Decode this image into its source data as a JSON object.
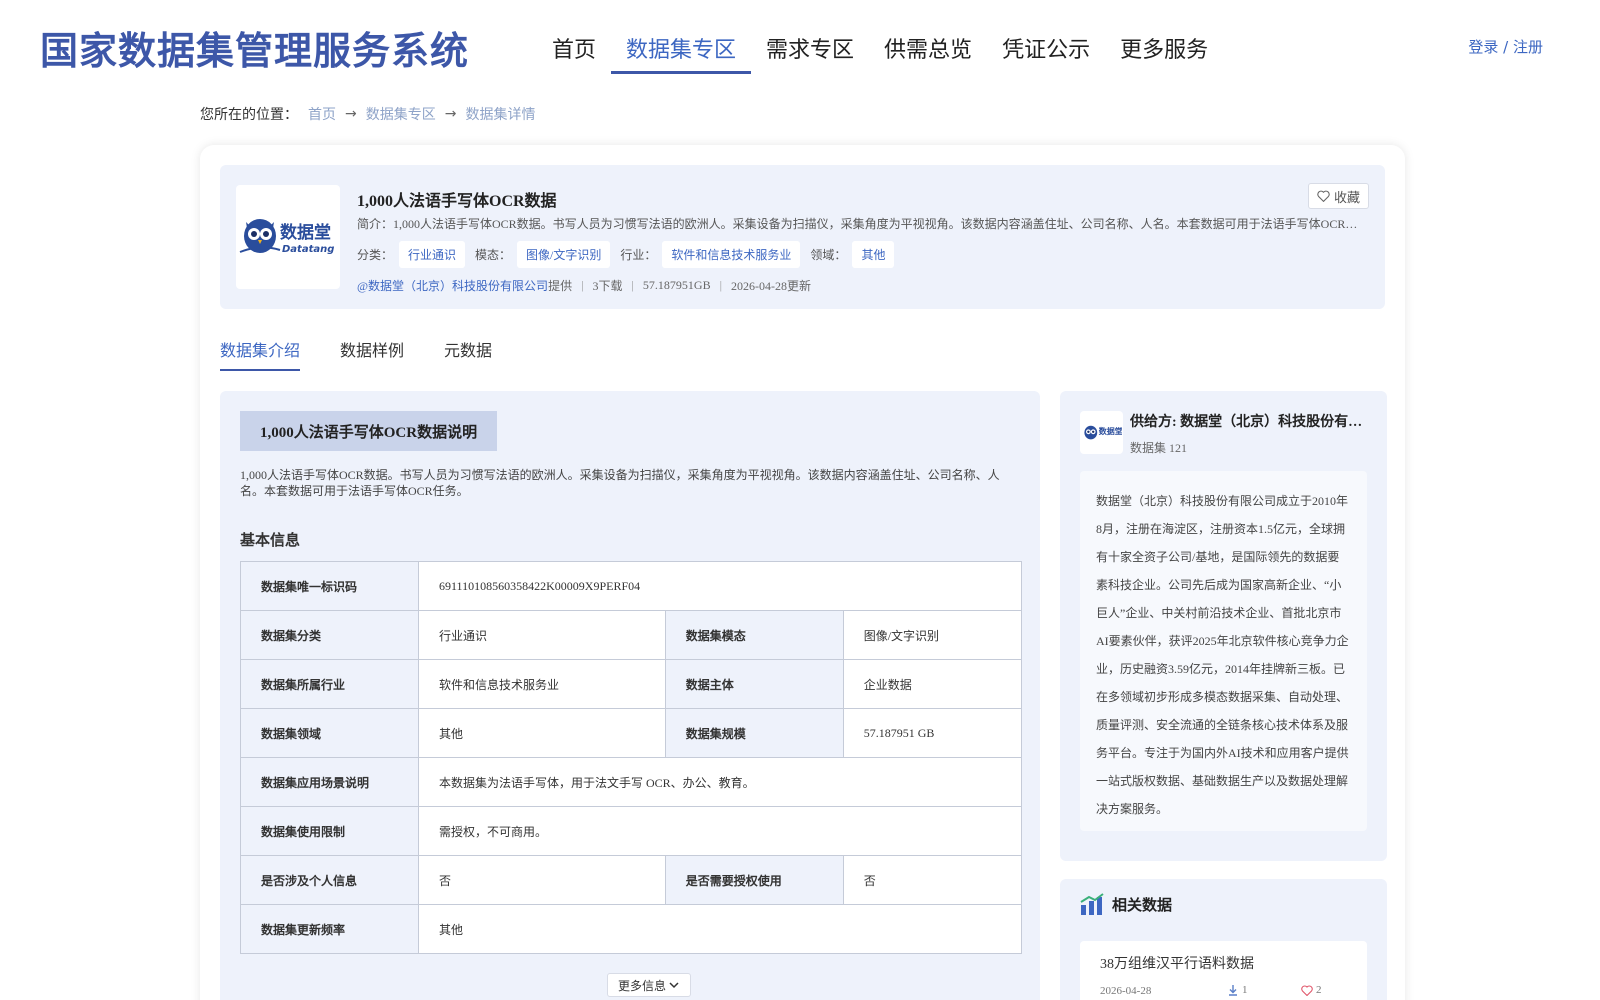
{
  "header": {
    "site_title": "国家数据集管理服务系统",
    "nav": [
      "首页",
      "数据集专区",
      "需求专区",
      "供需总览",
      "凭证公示",
      "更多服务"
    ],
    "active_nav": "数据集专区",
    "login": "登录 / 注册"
  },
  "breadcrumb": {
    "label": "您所在的位置：",
    "items": [
      "首页",
      "数据集专区",
      "数据集详情"
    ]
  },
  "dataset": {
    "logo_text": "数据堂",
    "logo_sub": "Datatang",
    "title": "1,000人法语手写体OCR数据",
    "favorite": "收藏",
    "intro": "简介：1,000人法语手写体OCR数据。书写人员为习惯写法语的欧洲人。采集设备为扫描仪，采集角度为平视视角。该数据内容涵盖住址、公司名称、人名。本套数据可用于法语手写体OCR任务。",
    "meta": {
      "category_label": "分类：",
      "category": "行业通识",
      "modality_label": "模态：",
      "modality": "图像/文字识别",
      "industry_label": "行业：",
      "industry": "软件和信息技术服务业",
      "domain_label": "领域：",
      "domain": "其他"
    },
    "provider": "@数据堂（北京）科技股份有限公司",
    "provider_suffix": "提供",
    "downloads": "3下载",
    "size": "57.187951GB",
    "updated": "2026-04-28更新"
  },
  "tabs": [
    "数据集介绍",
    "数据样例",
    "元数据"
  ],
  "intro_section": {
    "heading": "1,000人法语手写体OCR数据说明",
    "description": "1,000人法语手写体OCR数据。书写人员为习惯写法语的欧洲人。采集设备为扫描仪，采集角度为平视视角。该数据内容涵盖住址、公司名称、人名。本套数据可用于法语手写体OCR任务。",
    "basic_title": "基本信息",
    "more": "更多信息"
  },
  "basic_info": {
    "r0": {
      "k": "数据集唯一标识码",
      "v": "691110108560358422K00009X9PERF04"
    },
    "r1": {
      "k1": "数据集分类",
      "v1": "行业通识",
      "k2": "数据集模态",
      "v2": "图像/文字识别"
    },
    "r2": {
      "k1": "数据集所属行业",
      "v1": "软件和信息技术服务业",
      "k2": "数据主体",
      "v2": "企业数据"
    },
    "r3": {
      "k1": "数据集领域",
      "v1": "其他",
      "k2": "数据集规模",
      "v2": "57.187951 GB"
    },
    "r4": {
      "k": "数据集应用场景说明",
      "v": "本数据集为法语手写体，用于法文手写 OCR、办公、教育。"
    },
    "r5": {
      "k": "数据集使用限制",
      "v": "需授权，不可商用。"
    },
    "r6": {
      "k1": "是否涉及个人信息",
      "v1": "否",
      "k2": "是否需要授权使用",
      "v2": "否"
    },
    "r7": {
      "k": "数据集更新频率",
      "v": "其他"
    }
  },
  "supplier": {
    "name": "供给方: 数据堂（北京）科技股份有限公司",
    "count": "数据集 121",
    "description": "数据堂（北京）科技股份有限公司成立于2010年8月，注册在海淀区，注册资本1.5亿元，全球拥有十家全资子公司/基地，是国际领先的数据要素科技企业。公司先后成为国家高新企业、“小巨人”企业、中关村前沿技术企业、首批北京市AI要素伙伴，获评2025年北京软件核心竞争力企业，历史融资3.59亿元，2014年挂牌新三板。已在多领域初步形成多模态数据采集、自动处理、质量评测、安全流通的全链条核心技术体系及服务平台。专注于为国内外AI技术和应用客户提供一站式版权数据、基础数据生产以及数据处理解决方案服务。"
  },
  "related": {
    "heading": "相关数据",
    "items": [
      {
        "title": "38万组维汉平行语料数据",
        "date": "2026-04-28",
        "downloads": "1",
        "likes": "2"
      }
    ]
  },
  "colors": {
    "brand": "#3d57a8",
    "link": "#3d67c2",
    "panel": "#eef2fb"
  },
  "icons": [
    "owl-logo-icon",
    "heart-icon",
    "arrow-right-icon",
    "chevron-down-icon",
    "download-icon",
    "bar-chart-icon"
  ]
}
